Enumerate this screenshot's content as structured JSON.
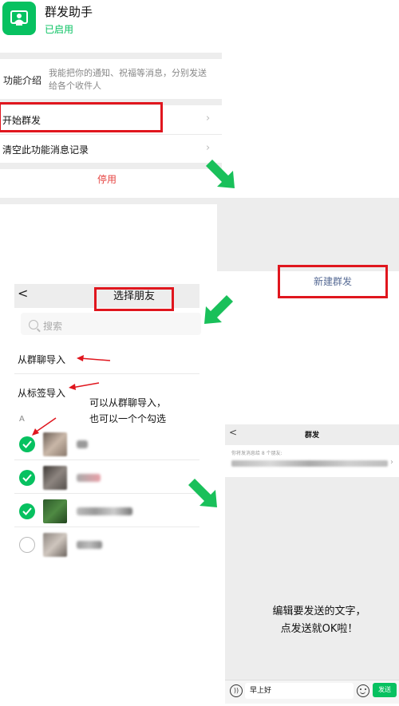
{
  "panel1": {
    "app_name": "群发助手",
    "status": "已启用",
    "intro_label": "功能介绍",
    "intro_text": "我能把你的通知、祝福等消息，分别发送给各个收件人",
    "start_label": "开始群发",
    "clear_label": "清空此功能消息记录",
    "disable_label": "停用"
  },
  "panel2": {
    "new_group_label": "新建群发"
  },
  "panel3": {
    "back": "<",
    "title": "选择朋友",
    "search_placeholder": "搜索",
    "import_group_chat": "从群聊导入",
    "import_tag": "从标签导入",
    "annotation_line1": "可以从群聊导入，",
    "annotation_line2": "也可以一个个勾选",
    "section_letter": "A",
    "contacts": [
      {
        "checked": true
      },
      {
        "checked": true
      },
      {
        "checked": true
      },
      {
        "checked": false
      }
    ]
  },
  "panel4": {
    "back": "<",
    "title": "群发",
    "recipients_header": "你将发消息给 8 个朋友:",
    "instruction_line1": "编辑要发送的文字，",
    "instruction_line2": "点发送就OK啦！",
    "message_input_value": "早上好",
    "send_label": "发送"
  },
  "colors": {
    "wechat_green": "#07c160",
    "annotation_red": "#e0161e",
    "link_blue": "#576b95",
    "disable_red": "#e64340",
    "background_gray": "#ededed"
  }
}
